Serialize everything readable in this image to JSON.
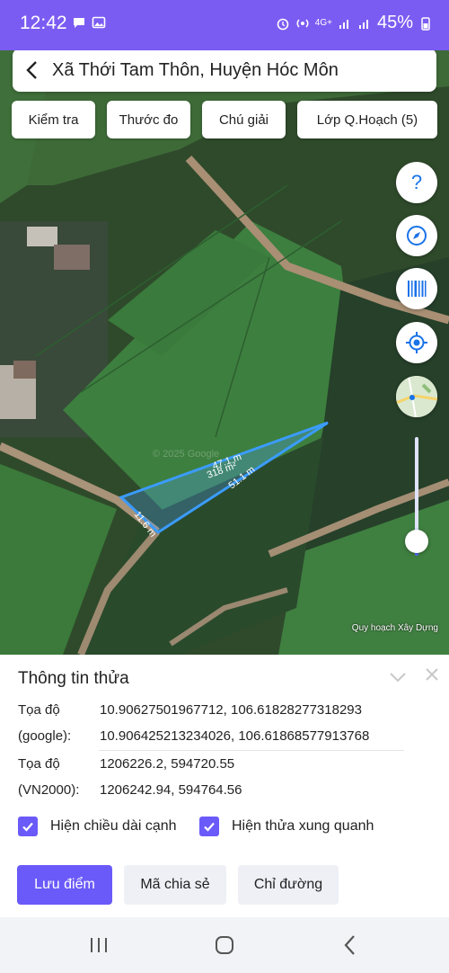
{
  "status_bar": {
    "time": "12:42",
    "network": "4G+",
    "battery": "45%"
  },
  "header": {
    "title": "Xã Thới Tam Thôn, Huyện Hóc Môn"
  },
  "toolbar": [
    {
      "label": "Kiểm tra"
    },
    {
      "label": "Thước đo"
    },
    {
      "label": "Chú giải"
    },
    {
      "label": "Lớp Q.Hoạch (5)"
    }
  ],
  "map": {
    "edge_labels": [
      "47.1 m",
      "51.1 m",
      "11.6 m"
    ],
    "area_label": "318 m²",
    "watermark": "© 2025 Google",
    "attribution": "Quy hoạch Xây Dựng",
    "zoom_level_fraction": 0.1,
    "parcel_outline_color": "#3b9cff"
  },
  "fab_icons": [
    "help-icon",
    "compass-icon",
    "barcode-icon",
    "my-location-icon",
    "map-layers-icon"
  ],
  "info": {
    "title": "Thông tin thửa",
    "rows": [
      {
        "label": "Tọa độ",
        "value": "10.90627501967712, 106.61828277318293"
      },
      {
        "label": "(google):",
        "value": "10.906425213234026, 106.61868577913768"
      },
      {
        "label": "Tọa độ",
        "value": "1206226.2, 594720.55"
      },
      {
        "label": "(VN2000):",
        "value": "1206242.94, 594764.56"
      }
    ],
    "checkboxes": [
      {
        "label": "Hiện chiều dài cạnh",
        "checked": true
      },
      {
        "label": "Hiện thửa xung quanh",
        "checked": true
      }
    ],
    "buttons": [
      {
        "label": "Lưu điểm"
      },
      {
        "label": "Mã chia sẻ"
      },
      {
        "label": "Chỉ đường"
      }
    ]
  },
  "colors": {
    "accent": "#6a5af9",
    "status_bar": "#7b5cf2"
  }
}
